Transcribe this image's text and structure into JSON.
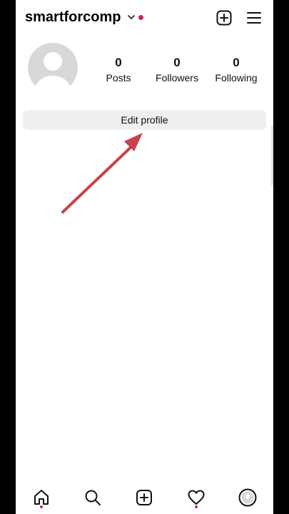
{
  "header": {
    "username": "smartforcomp",
    "icons": [
      "chevron-down-icon",
      "new-post-icon",
      "menu-icon"
    ],
    "notification_dot_color": "#d3224f"
  },
  "profile": {
    "stats": [
      {
        "count": "0",
        "label": "Posts"
      },
      {
        "count": "0",
        "label": "Followers"
      },
      {
        "count": "0",
        "label": "Following"
      }
    ],
    "edit_label": "Edit profile"
  },
  "annotation": {
    "arrow_color": "#c8414b"
  },
  "bottom_nav": {
    "items": [
      "home-icon",
      "search-icon",
      "create-icon",
      "activity-icon",
      "profile-icon"
    ]
  }
}
